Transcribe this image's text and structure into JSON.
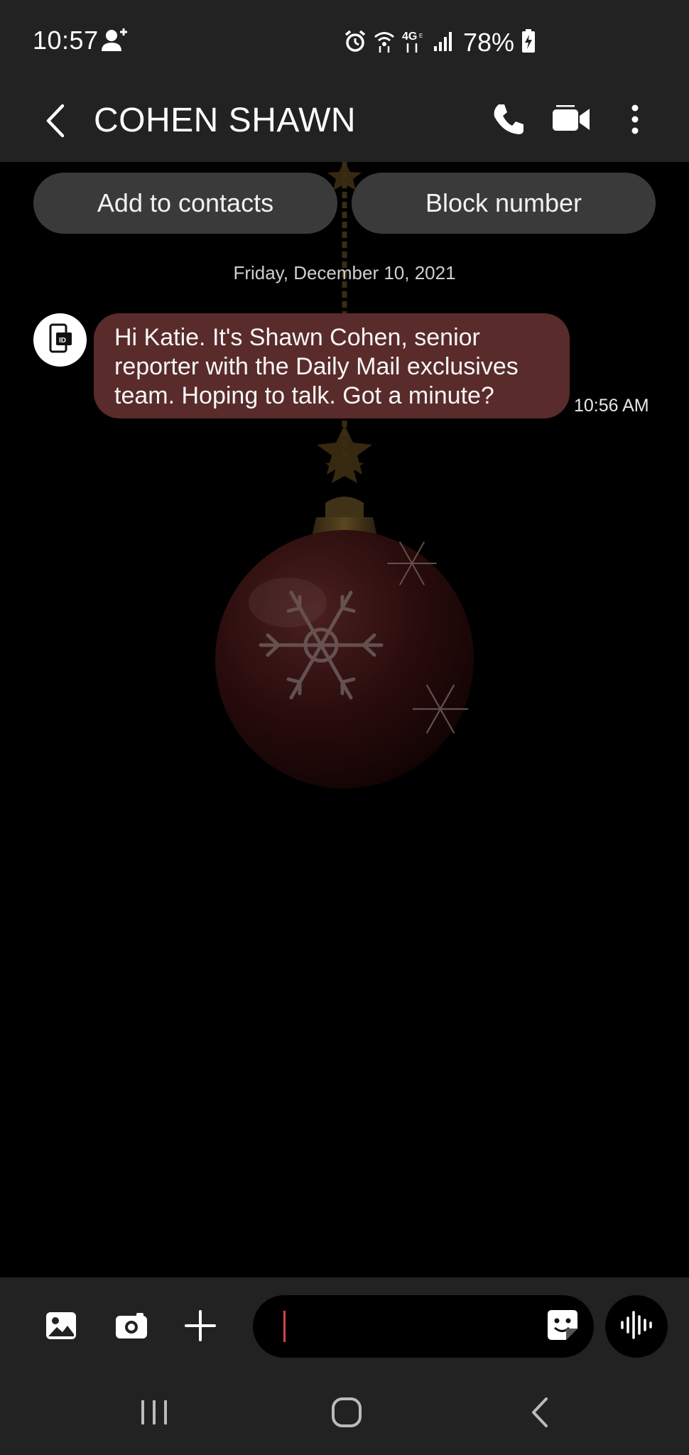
{
  "status_bar": {
    "time": "10:57",
    "battery": "78%",
    "icons": [
      "person-add-icon",
      "alarm-icon",
      "wifi-icon",
      "4g-lte-icon",
      "signal-icon",
      "battery-charging-icon"
    ]
  },
  "header": {
    "contact_name": "COHEN SHAWN",
    "icons": [
      "back-icon",
      "phone-icon",
      "video-call-icon",
      "more-icon"
    ]
  },
  "suggestions": {
    "add_contact": "Add to contacts",
    "block_number": "Block number"
  },
  "conversation": {
    "date": "Friday, December 10, 2021",
    "messages": [
      {
        "text": "Hi Katie. It's Shawn Cohen, senior reporter with the Daily Mail exclusives team. Hoping to talk. Got a minute?",
        "time": "10:56 AM",
        "direction": "incoming"
      }
    ]
  },
  "composer": {
    "value": "",
    "icons": [
      "gallery-icon",
      "camera-icon",
      "add-icon",
      "sticker-icon",
      "voice-recorder-icon"
    ]
  },
  "nav_bar": {
    "icons": [
      "recent-apps-icon",
      "home-icon",
      "nav-back-icon"
    ]
  },
  "colors": {
    "bar_background": "#222222",
    "incoming_bubble": "#5a2b2b",
    "pill_background": "#3a3a3a",
    "caret": "#d2463c"
  }
}
